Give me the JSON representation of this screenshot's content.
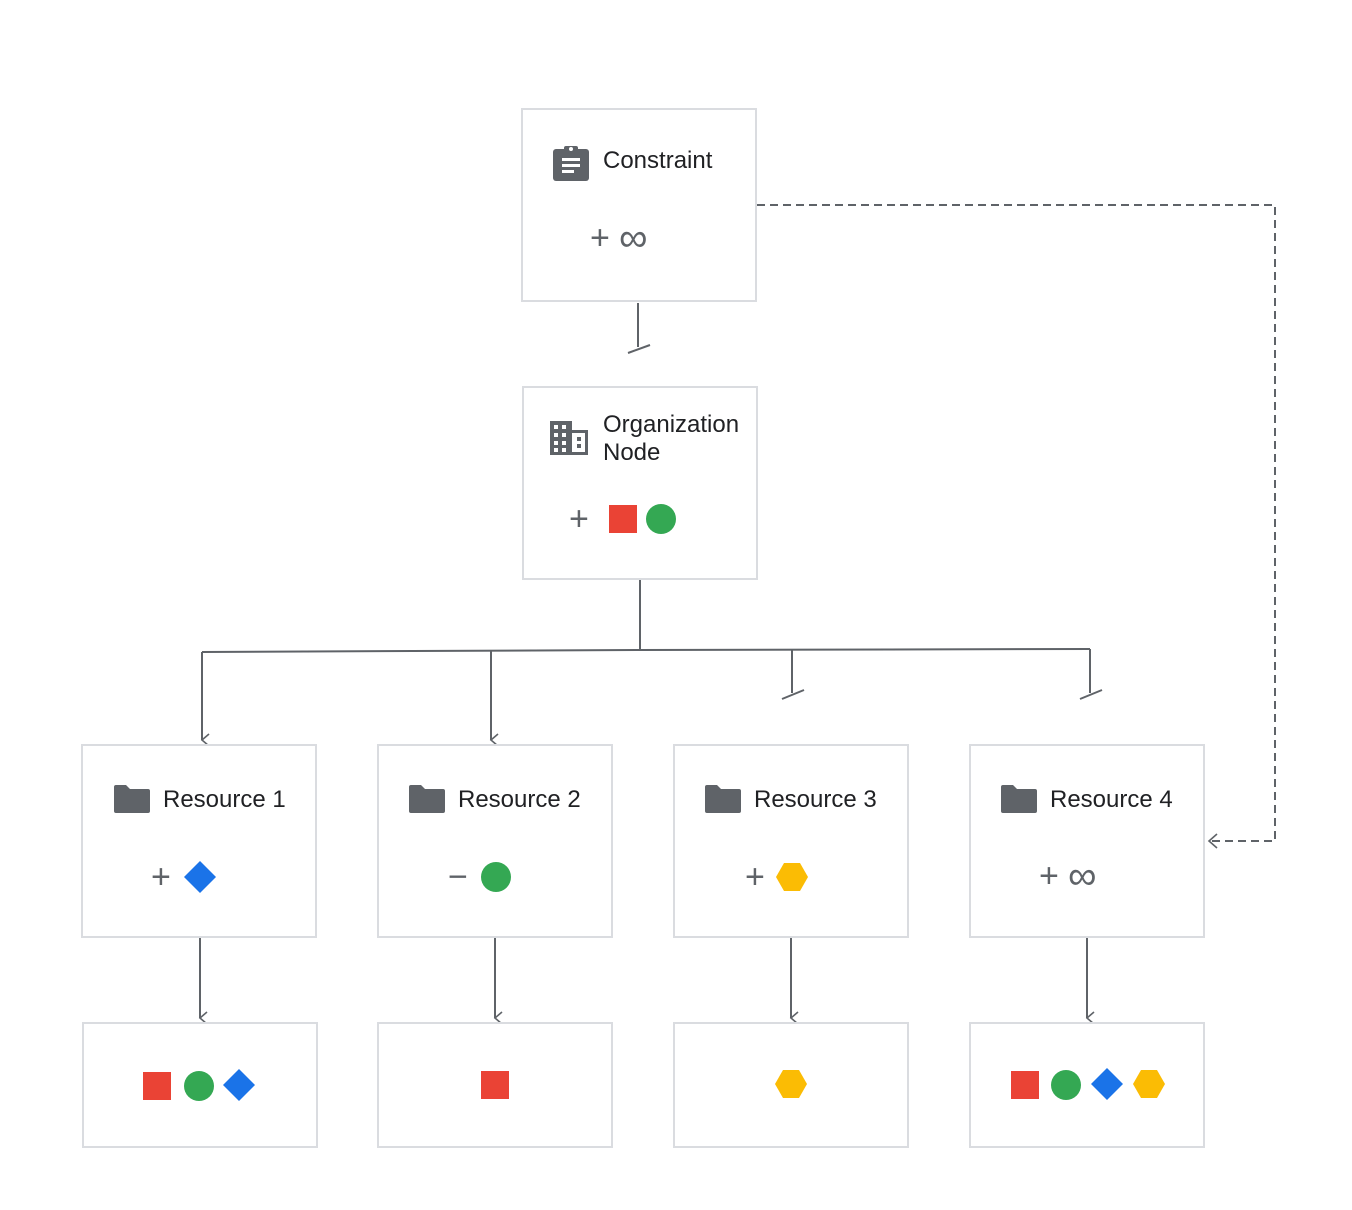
{
  "colors": {
    "red": "#ea4335",
    "green": "#34a853",
    "blue": "#1a73e8",
    "yellow": "#fbbc04",
    "icon": "#5f6368",
    "border": "#dadce0",
    "line": "#5f6368"
  },
  "constraint": {
    "title": "Constraint",
    "icon": "clipboard-icon",
    "operator": "+",
    "value": "∞"
  },
  "org_node": {
    "title_line1": "Organization",
    "title_line2": "Node",
    "icon": "building-icon",
    "operator": "+",
    "shapes": [
      "square-red",
      "circle-green"
    ]
  },
  "resources": [
    {
      "title": "Resource 1",
      "icon": "folder-icon",
      "operator": "+",
      "shapes": [
        "diamond-blue"
      ],
      "inherits": true,
      "effective": [
        "square-red",
        "circle-green",
        "diamond-blue"
      ]
    },
    {
      "title": "Resource 2",
      "icon": "folder-icon",
      "operator": "−",
      "shapes": [
        "circle-green"
      ],
      "inherits": true,
      "effective": [
        "square-red"
      ]
    },
    {
      "title": "Resource 3",
      "icon": "folder-icon",
      "operator": "+",
      "shapes": [
        "hexagon-yellow"
      ],
      "inherits": false,
      "effective": [
        "hexagon-yellow"
      ]
    },
    {
      "title": "Resource 4",
      "icon": "folder-icon",
      "operator": "+",
      "value": "∞",
      "inherits": false,
      "effective": [
        "square-red",
        "circle-green",
        "diamond-blue",
        "hexagon-yellow"
      ]
    }
  ],
  "edges": {
    "constraint_to_org": "blocked",
    "constraint_to_resource4": "dashed-arrow",
    "org_to_resource1": "arrow",
    "org_to_resource2": "arrow",
    "org_to_resource3": "blocked",
    "org_to_resource4": "blocked",
    "resource_to_effective": "arrow"
  }
}
